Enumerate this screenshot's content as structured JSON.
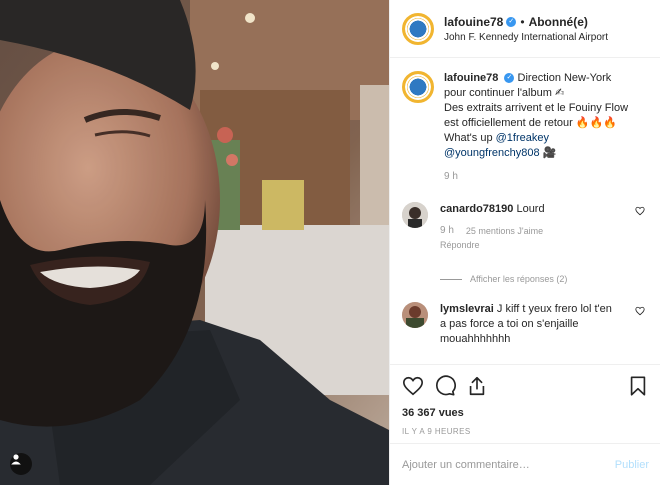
{
  "post": {
    "username": "lafouine78",
    "follow_state": "Abonné(e)",
    "separator": "•",
    "location": "John F. Kennedy International Airport",
    "verified_icon": "verified-badge-icon"
  },
  "caption": {
    "username": "lafouine78",
    "text_1": "Direction New-York pour continuer l'album ✍",
    "text_2": "Des extraits arrivent et le Fouiny Flow est officiellement de retour 🔥🔥🔥",
    "text_3": "What's up ",
    "mention_1": "@1freakey",
    "mention_2": "@youngfrenchy808",
    "text_4": " 🎥",
    "time": "9 h"
  },
  "comments": [
    {
      "username": "canardo78190",
      "text": "Lourd",
      "time": "9 h",
      "likes": "25 mentions J'aime",
      "reply": "Répondre",
      "view_replies": "Afficher les réponses (2)"
    },
    {
      "username": "lymslevrai",
      "text": "J kiff t yeux frero lol t'en a pas force a toi on s'enjaille mouahhhhhhh"
    }
  ],
  "actions": {
    "views": "36 367 vues",
    "time_ago": "IL Y A 9 HEURES"
  },
  "add_comment": {
    "placeholder": "Ajouter un commentaire…",
    "publish": "Publier"
  },
  "colors": {
    "accent_blue": "#3897f0",
    "mention_blue": "#003569",
    "muted": "#999999",
    "publish_disabled": "#b2dffc"
  }
}
